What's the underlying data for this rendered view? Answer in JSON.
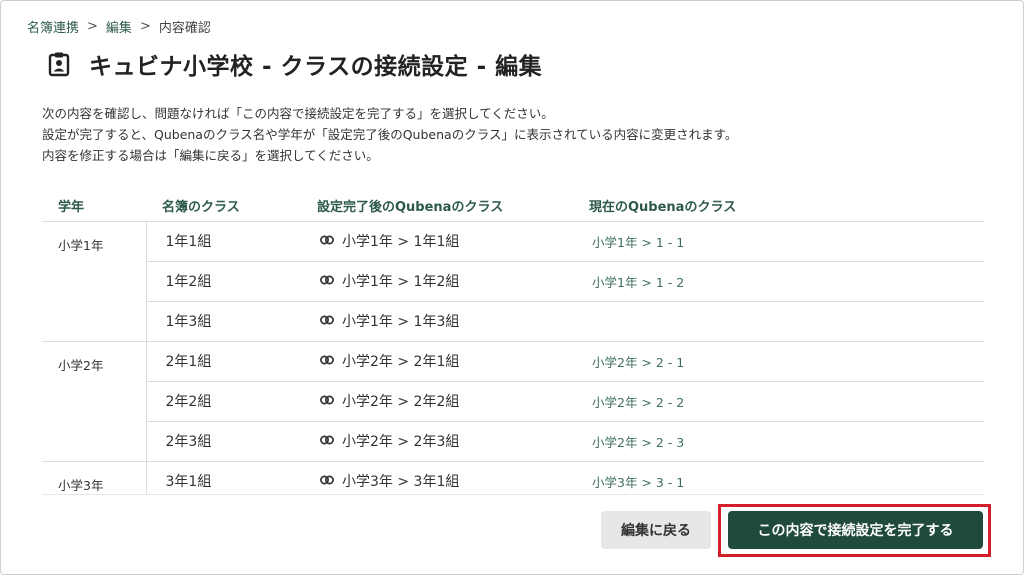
{
  "breadcrumb": {
    "items": [
      "名簿連携",
      "編集",
      "内容確認"
    ],
    "separator": ">"
  },
  "title": "キュビナ小学校 - クラスの接続設定 - 編集",
  "description": [
    "次の内容を確認し、問題なければ「この内容で接続設定を完了する」を選択してください。",
    "設定が完了すると、Qubenaのクラス名や学年が「設定完了後のQubenaのクラス」に表示されている内容に変更されます。",
    "内容を修正する場合は「編集に戻る」を選択してください。"
  ],
  "table": {
    "headers": [
      "学年",
      "名簿のクラス",
      "設定完了後のQubenaのクラス",
      "現在のQubenaのクラス"
    ],
    "groups": [
      {
        "grade": "小学1年",
        "rows": [
          {
            "class": "1年1組",
            "after": "小学1年 > 1年1組",
            "current": "小学1年 > 1 - 1"
          },
          {
            "class": "1年2組",
            "after": "小学1年 > 1年2組",
            "current": "小学1年 > 1 - 2"
          },
          {
            "class": "1年3組",
            "after": "小学1年 > 1年3組",
            "current": ""
          }
        ]
      },
      {
        "grade": "小学2年",
        "rows": [
          {
            "class": "2年1組",
            "after": "小学2年 > 2年1組",
            "current": "小学2年 > 2 - 1"
          },
          {
            "class": "2年2組",
            "after": "小学2年 > 2年2組",
            "current": "小学2年 > 2 - 2"
          },
          {
            "class": "2年3組",
            "after": "小学2年 > 2年3組",
            "current": "小学2年 > 2 - 3"
          }
        ]
      },
      {
        "grade": "小学3年",
        "rows": [
          {
            "class": "3年1組",
            "after": "小学3年 > 3年1組",
            "current": "小学3年 > 3 - 1"
          }
        ]
      }
    ]
  },
  "buttons": {
    "back": "編集に戻る",
    "complete": "この内容で接続設定を完了する"
  },
  "icons": {
    "title": "clipboard-user-icon",
    "link": "link-icon"
  },
  "colors": {
    "accent": "#1f4a3c",
    "header_text": "#2e5a4c",
    "highlight_border": "#d31f2a"
  }
}
